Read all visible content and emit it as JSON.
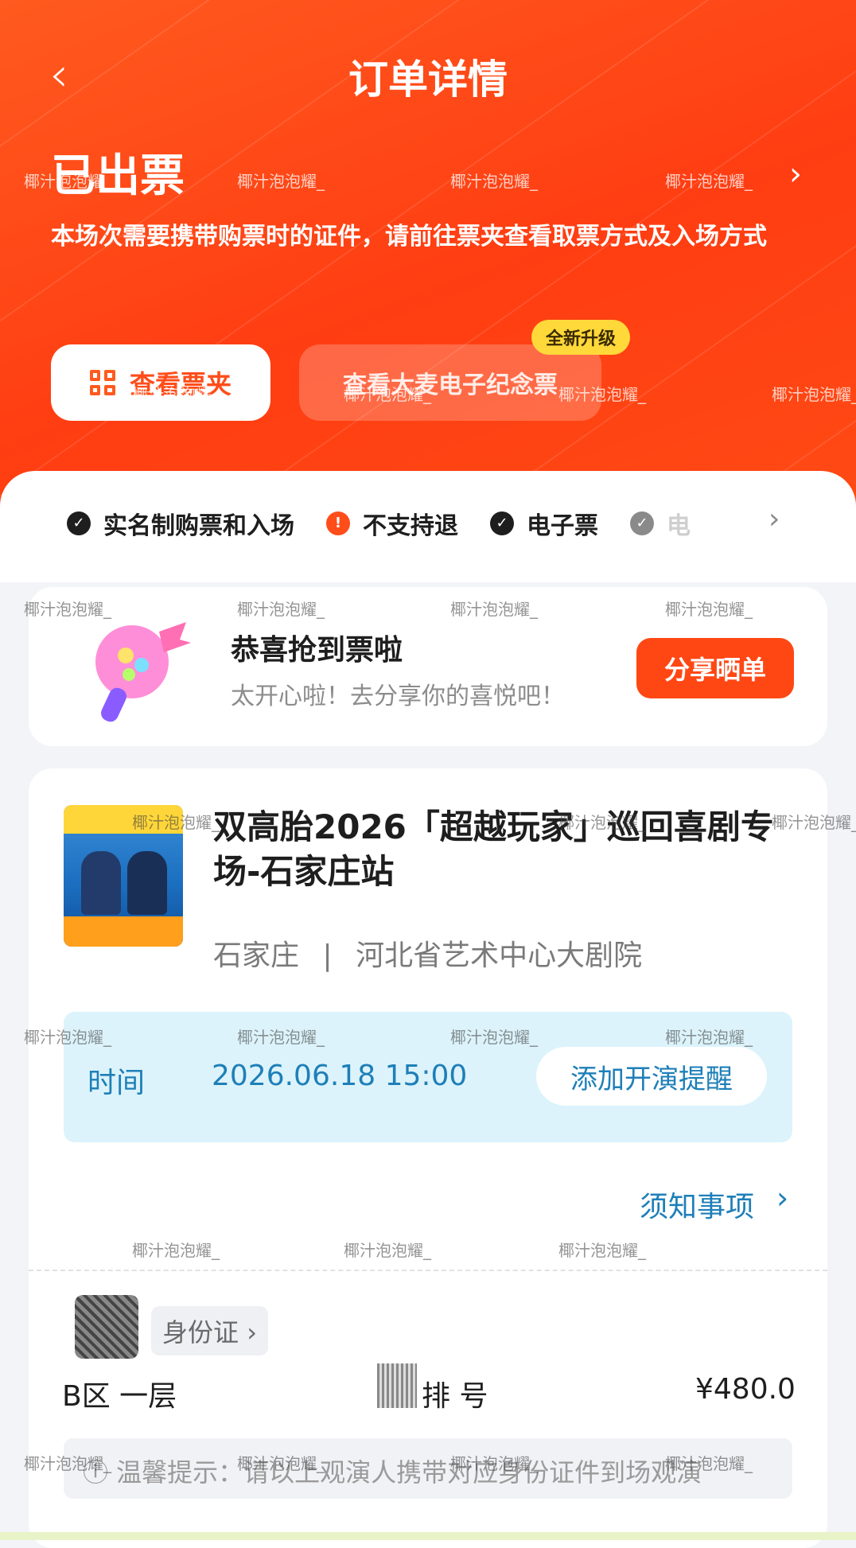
{
  "header": {
    "back_icon": "chevron-left-icon",
    "title": "订单详情"
  },
  "status": {
    "title": "已出票",
    "description": "本场次需要携带购票时的证件，请前往票夹查看取票方式及入场方式"
  },
  "actions": {
    "wallet_label": "查看票夹",
    "souvenir_label": "查看大麦电子纪念票",
    "souvenir_badge": "全新升级"
  },
  "features": [
    {
      "label": "实名制购票和入场",
      "icon": "check-circle-icon"
    },
    {
      "label": "不支持退",
      "icon": "exclamation-circle-icon"
    },
    {
      "label": "电子票",
      "icon": "check-circle-icon"
    },
    {
      "label": "电",
      "icon": "check-circle-icon"
    }
  ],
  "celebrate": {
    "title": "恭喜抢到票啦",
    "subtitle": "太开心啦！去分享你的喜悦吧！",
    "share_label": "分享晒单"
  },
  "show": {
    "title": "双高胎2026「超越玩家」巡回喜剧专场-石家庄站",
    "city": "石家庄",
    "separator": "|",
    "venue": "河北省艺术中心大剧院",
    "time_label": "时间",
    "time_value": "2026.06.18 15:00",
    "reminder_label": "添加开演提醒",
    "notice_label": "须知事项"
  },
  "ticket": {
    "id_label": "身份证",
    "area": "B区 一层",
    "seat": "排 号",
    "price": "¥480.0",
    "tip": "ⓘ 温馨提示：请以上观演人携带对应身份证件到场观演"
  },
  "watermark_text": "椰汁泡泡耀_",
  "colors": {
    "primary": "#ff4d1a",
    "accent_blue": "#1e7fb8",
    "badge_yellow": "#ffd83a"
  }
}
